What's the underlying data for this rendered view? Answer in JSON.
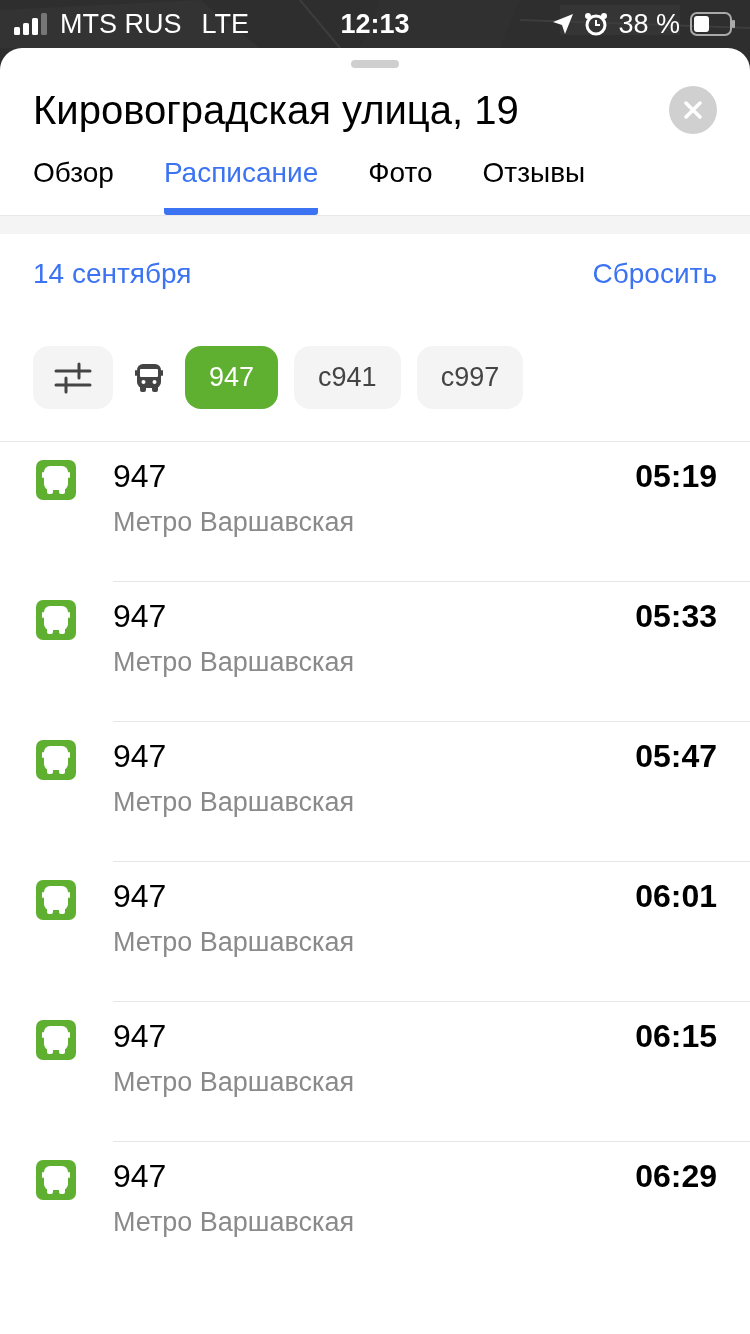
{
  "status_bar": {
    "carrier": "MTS RUS",
    "network": "LTE",
    "time": "12:13",
    "battery": "38 %"
  },
  "title": "Кировоградская улица, 19",
  "tabs": [
    {
      "label": "Обзор",
      "selected": false
    },
    {
      "label": "Расписание",
      "selected": true
    },
    {
      "label": "Фото",
      "selected": false
    },
    {
      "label": "Отзывы",
      "selected": false
    }
  ],
  "date": "14 сентября",
  "reset": "Сбросить",
  "filters": [
    {
      "kind": "settings"
    },
    {
      "kind": "bus"
    },
    {
      "kind": "route",
      "label": "947",
      "selected": true
    },
    {
      "kind": "route",
      "label": "с941",
      "selected": false
    },
    {
      "kind": "route",
      "label": "с997",
      "selected": false
    }
  ],
  "departures": [
    {
      "route": "947",
      "destination": "Метро Варшавская",
      "time": "05:19"
    },
    {
      "route": "947",
      "destination": "Метро Варшавская",
      "time": "05:33"
    },
    {
      "route": "947",
      "destination": "Метро Варшавская",
      "time": "05:47"
    },
    {
      "route": "947",
      "destination": "Метро Варшавская",
      "time": "06:01"
    },
    {
      "route": "947",
      "destination": "Метро Варшавская",
      "time": "06:15"
    },
    {
      "route": "947",
      "destination": "Метро Варшавская",
      "time": "06:29"
    }
  ]
}
